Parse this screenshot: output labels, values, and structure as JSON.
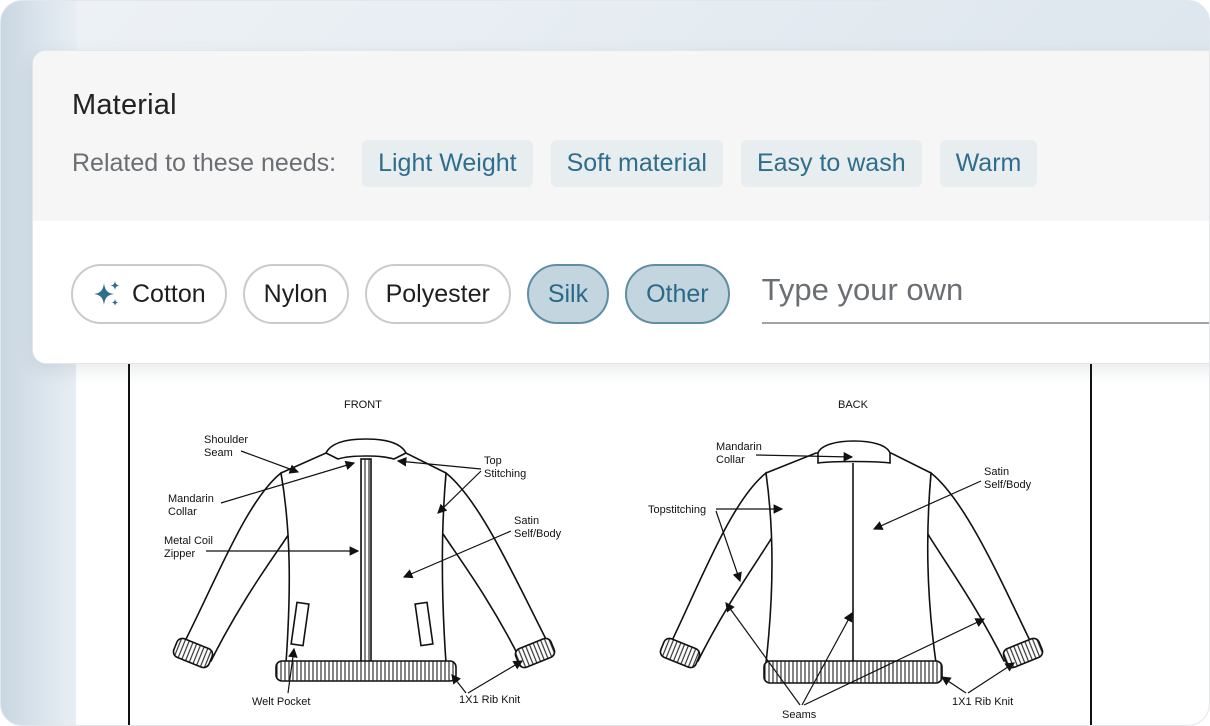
{
  "panel": {
    "title": "Material",
    "needs_label": "Related to these needs:",
    "needs": [
      "Light Weight",
      "Soft material",
      "Easy to wash",
      "Warm"
    ],
    "options": [
      {
        "label": "Cotton",
        "icon": "sparkle-icon",
        "selected": false
      },
      {
        "label": "Nylon",
        "selected": false
      },
      {
        "label": "Polyester",
        "selected": false
      },
      {
        "label": "Silk",
        "selected": true
      },
      {
        "label": "Other",
        "selected": true
      }
    ],
    "custom_input": {
      "placeholder": "Type your own",
      "value": ""
    },
    "colors": {
      "accent": "#2e6e8c",
      "selected_bg": "#c3d5de",
      "chip_bg": "#e8edf0"
    }
  },
  "diagram": {
    "front_title": "FRONT",
    "back_title": "BACK",
    "front_labels": {
      "shoulder_seam": [
        "Shoulder",
        "Seam"
      ],
      "mandarin_collar": [
        "Mandarin",
        "Collar"
      ],
      "metal_coil_zipper": [
        "Metal Coil",
        "Zipper"
      ],
      "top_stitching": [
        "Top",
        "Stitching"
      ],
      "satin": [
        "Satin",
        "Self/Body"
      ],
      "welt_pocket": "Welt Pocket",
      "rib_knit": "1X1 Rib Knit"
    },
    "back_labels": {
      "mandarin_collar": [
        "Mandarin",
        "Collar"
      ],
      "topstitching": "Topstitching",
      "satin": [
        "Satin",
        "Self/Body"
      ],
      "seams": "Seams",
      "rib_knit": "1X1 Rib Knit"
    }
  }
}
